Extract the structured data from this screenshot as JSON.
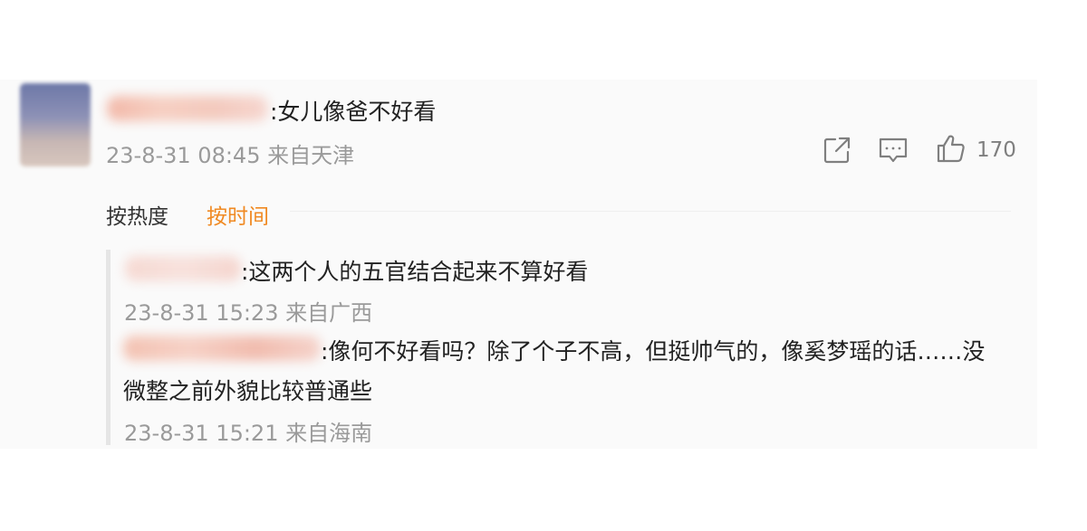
{
  "comment": {
    "text": ":女儿像爸不好看",
    "timestamp_location": "23-8-31 08:45 来自天津",
    "like_count": "170",
    "icons": {
      "share": "share-icon",
      "reply": "comment-icon",
      "like": "thumbs-up-icon"
    }
  },
  "sort_tabs": {
    "hot": "按热度",
    "time": "按时间"
  },
  "replies": [
    {
      "text": ":这两个人的五官结合起来不算好看",
      "meta": "23-8-31 15:23 来自广西"
    },
    {
      "text_line1": ":像何不好看吗？除了个子不高，但挺帅气的，像奚梦瑶的话……没",
      "text_line2": "微整之前外貌比较普通些",
      "meta": "23-8-31 15:21 来自海南"
    }
  ],
  "colors": {
    "accent": "#f08a23",
    "meta_text": "#9a9a9a",
    "body_text": "#222222",
    "panel_bg": "#fafafa"
  }
}
